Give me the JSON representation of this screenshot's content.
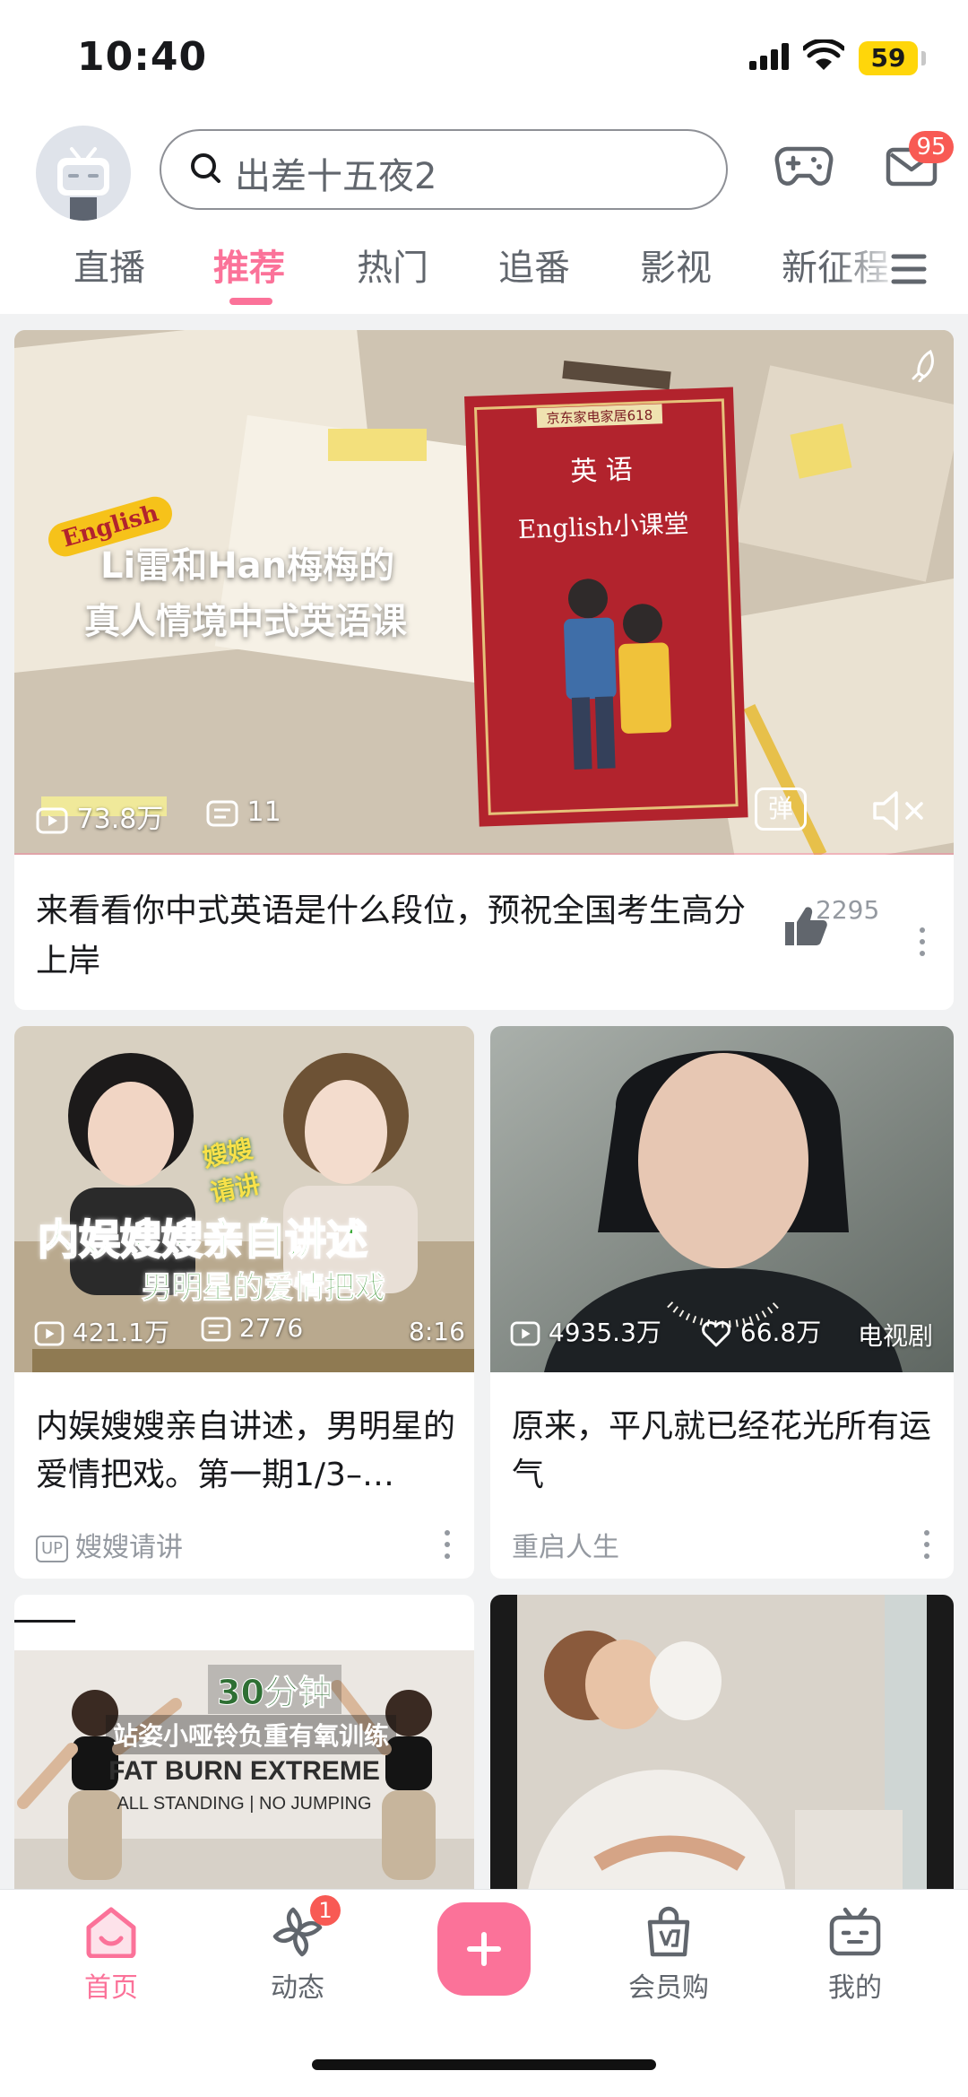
{
  "status_bar": {
    "time": "10:40",
    "battery": "59"
  },
  "header": {
    "search_placeholder": "出差十五夜2",
    "mail_badge": "95"
  },
  "tabs": [
    "直播",
    "推荐",
    "热门",
    "追番",
    "影视",
    "新征程"
  ],
  "active_tab": "推荐",
  "hero": {
    "title": "来看看你中式英语是什么段位，预祝全国考生高分上岸",
    "views": "73.8万",
    "danmaku": "11",
    "likes": "2295",
    "overlay_line1": "Li雷和Han梅梅的",
    "overlay_line2": "真人情境中式英语课",
    "sticker": "English",
    "book_tag": "京东家电家居618",
    "book_title": "英 语",
    "book_subtitle": "English小课堂",
    "danmaku_btn": "弹"
  },
  "cards": [
    {
      "title": "内娱嫂嫂亲自讲述，男明星的爱情把戏。第一期1/3–…",
      "views": "421.1万",
      "danmaku": "2776",
      "duration": "8:16",
      "author": "嫂嫂请讲",
      "up_badge": "UP",
      "overlay_line1": "内娱嫂嫂亲自讲述",
      "overlay_line2": "男明星的爱情把戏",
      "overlay_tag": "嫂嫂\n请讲"
    },
    {
      "title": "原来，平凡就已经花光所有运气",
      "views": "4935.3万",
      "likes": "66.8万",
      "category": "电视剧",
      "author": "重启人生"
    },
    {
      "overlay_line1": "30分钟",
      "overlay_line2": "站姿小哑铃负重有氧训练",
      "overlay_line3": "FAT BURN EXTREME",
      "overlay_line4": "ALL STANDING | NO JUMPING"
    },
    {}
  ],
  "bottom_nav": {
    "home": "首页",
    "dynamic": "动态",
    "dynamic_badge": "1",
    "vip_shop": "会员购",
    "mine": "我的"
  },
  "colors": {
    "accent": "#fb7299",
    "badge": "#f85a54",
    "text_secondary": "#9499a0"
  }
}
